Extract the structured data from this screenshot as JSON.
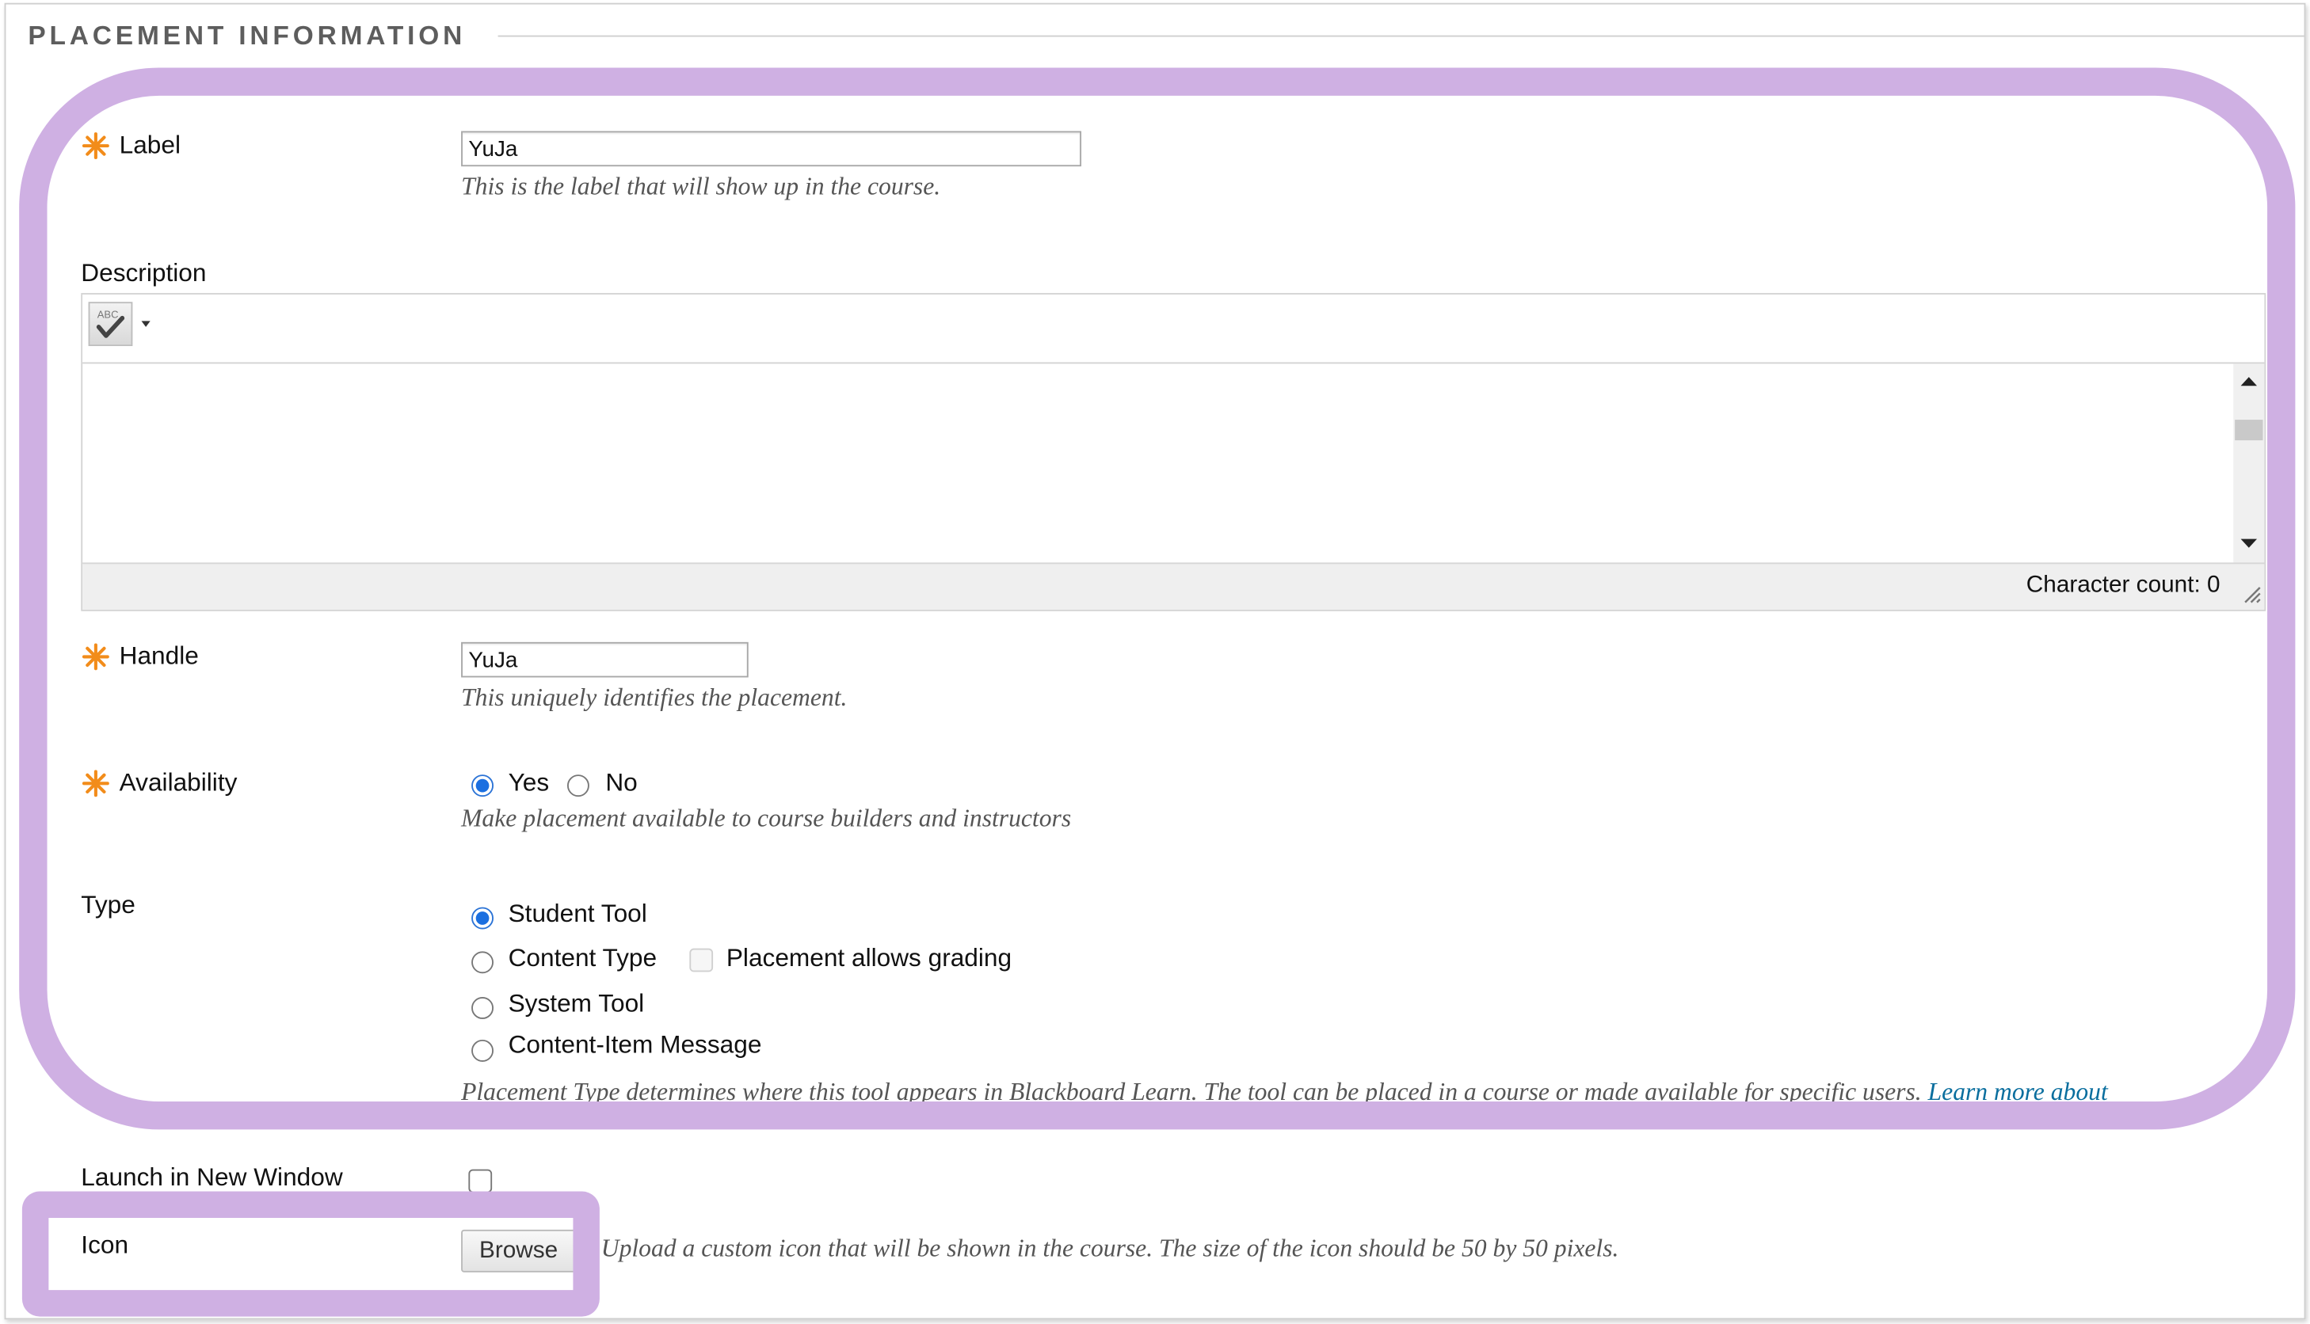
{
  "section": {
    "title": "PLACEMENT INFORMATION"
  },
  "label_field": {
    "label": "Label",
    "value": "YuJa",
    "hint": "This is the label that will show up in the course."
  },
  "description_field": {
    "label": "Description",
    "character_count": "Character count: 0"
  },
  "handle_field": {
    "label": "Handle",
    "value": "YuJa",
    "hint": "This uniquely identifies the placement."
  },
  "availability_field": {
    "label": "Availability",
    "options": [
      "Yes",
      "No"
    ],
    "selected": "Yes",
    "hint": "Make placement available to course builders and instructors"
  },
  "type_field": {
    "label": "Type",
    "options": [
      "Student Tool",
      "Content Type",
      "System Tool",
      "Content-Item Message"
    ],
    "selected": "Student Tool",
    "grading_label": "Placement allows grading",
    "hint": "Placement Type determines where this tool appears in Blackboard Learn. The tool can be placed in a course or made available for specific users.",
    "link_text": "Learn more about"
  },
  "launch_field": {
    "label": "Launch in New Window"
  },
  "icon_field": {
    "label": "Icon",
    "browse_label": "Browse",
    "hint": "Upload a custom icon that will be shown in the course. The size of the icon should be 50 by 50 pixels."
  },
  "colors": {
    "required_star": "#f28c1a",
    "highlight": "#cfb0e3",
    "radio_selected": "#1b6fe0",
    "link": "#0a6e9e"
  },
  "icons": {
    "required": "asterisk-icon",
    "spellcheck": "spellcheck-icon"
  }
}
